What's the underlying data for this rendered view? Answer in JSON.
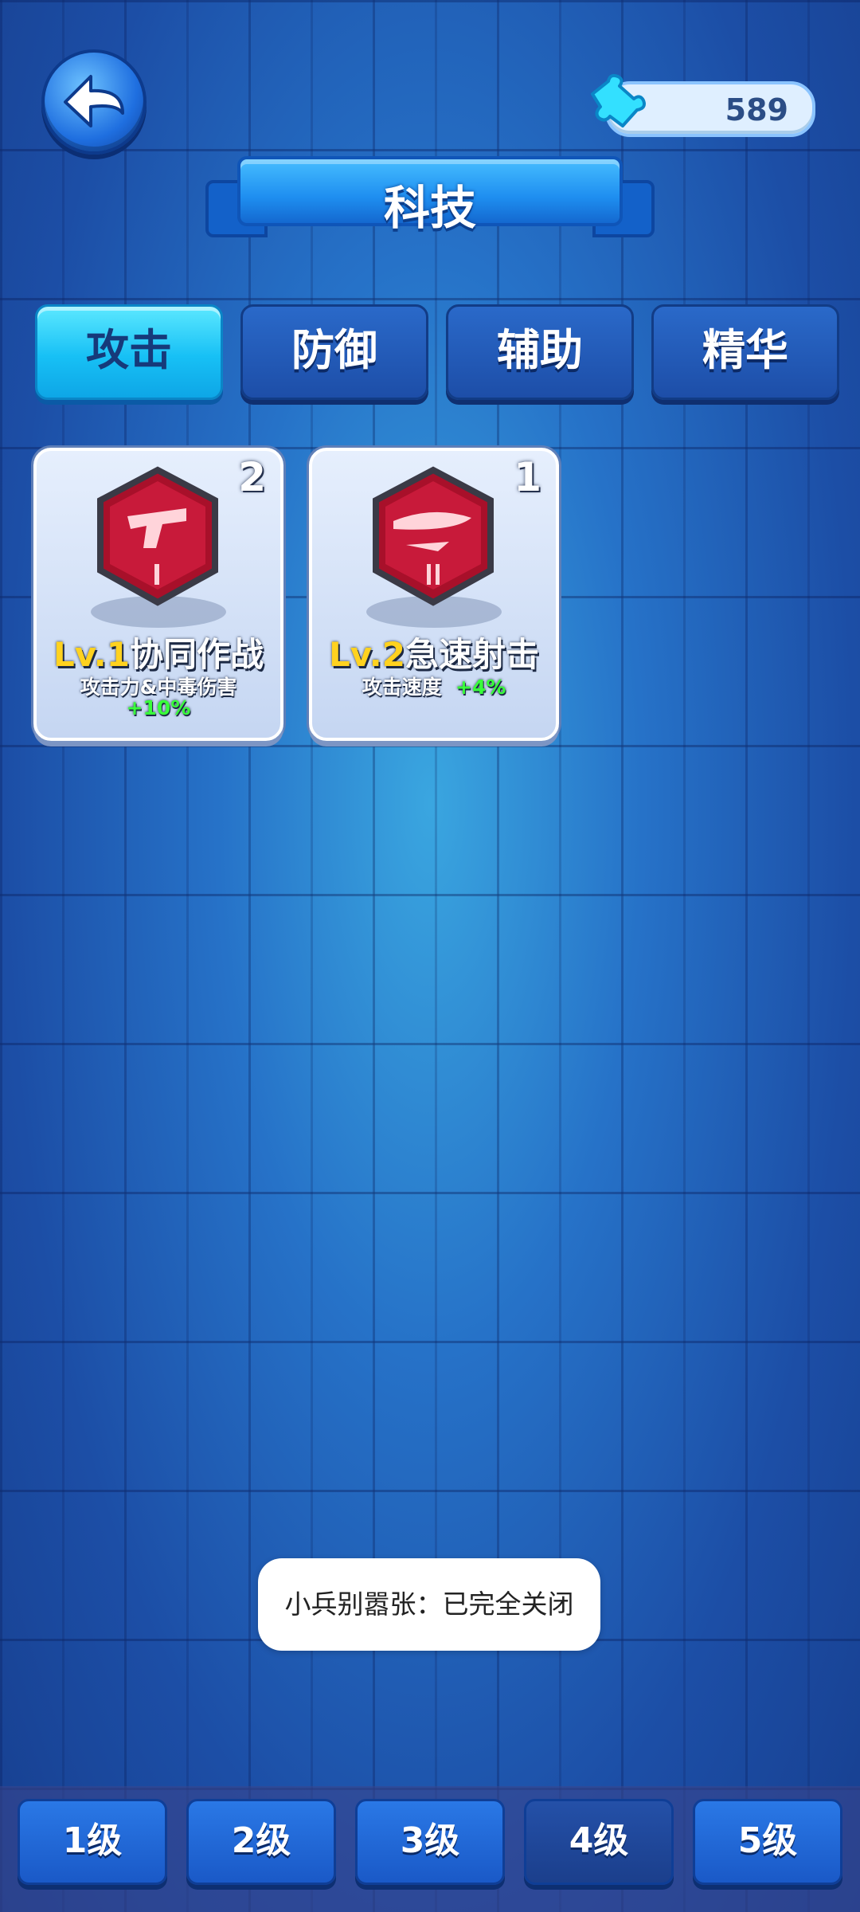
{
  "header": {
    "title": "科技",
    "currency_value": "589",
    "currency_icon": "puzzle-piece-icon"
  },
  "tabs": [
    {
      "label": "攻击",
      "active": true
    },
    {
      "label": "防御",
      "active": false
    },
    {
      "label": "辅助",
      "active": false
    },
    {
      "label": "精华",
      "active": false
    }
  ],
  "cards": [
    {
      "count": "2",
      "level": "Lv.1",
      "name": "协同作战",
      "desc": "攻击力&中毒伤害",
      "bonus": "+10%",
      "icon": "pistol-icon",
      "tier": "I"
    },
    {
      "count": "1",
      "level": "Lv.2",
      "name": "急速射击",
      "desc": "攻击速度",
      "bonus": "+4%",
      "icon": "bullet-icon",
      "tier": "II"
    }
  ],
  "toast": "小兵别嚣张：已完全关闭",
  "level_buttons": [
    "1级",
    "2级",
    "3级",
    "4级",
    "5级"
  ],
  "colors": {
    "accent": "#17c0f5",
    "bonus": "#39ff3a",
    "level": "#ffd21f"
  }
}
